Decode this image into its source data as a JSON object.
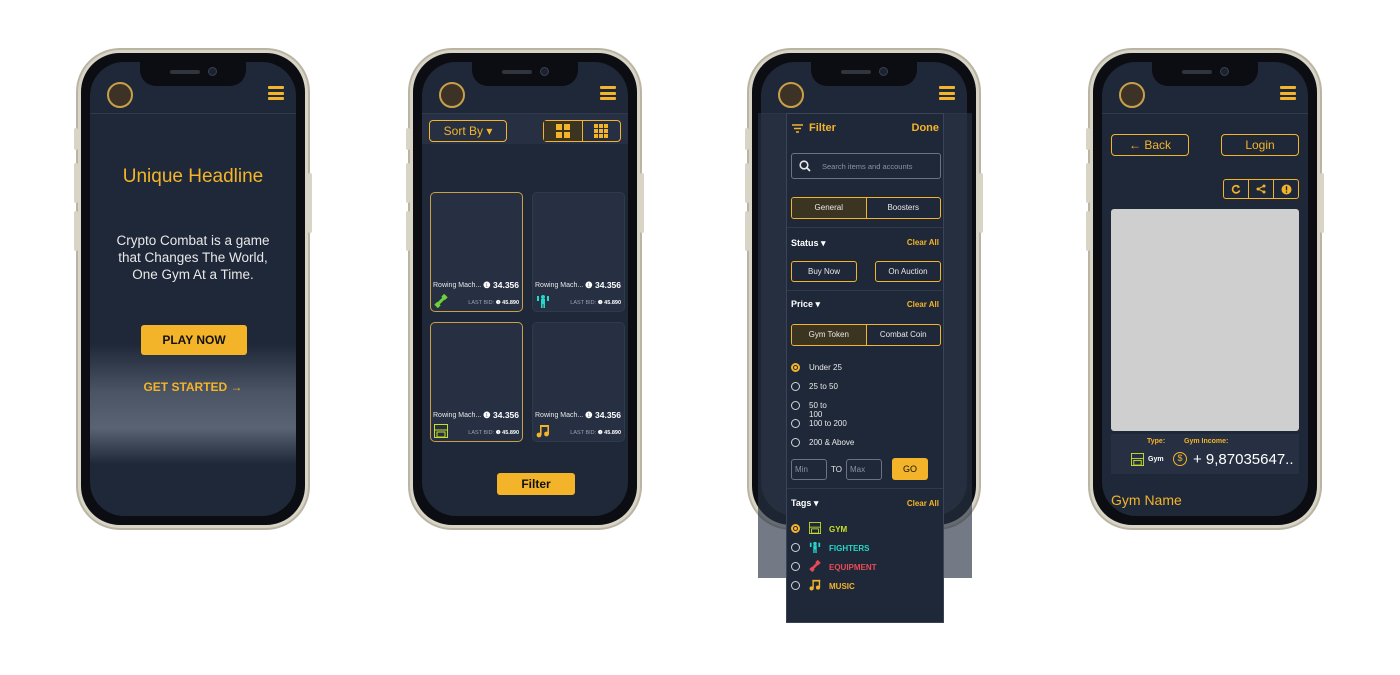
{
  "screen1": {
    "headline": "Unique Headline",
    "tagline": "Crypto Combat is  a game that Changes The World, One Gym At a Time.",
    "play_label": "PLAY NOW",
    "get_started_label": "GET STARTED →"
  },
  "screen2": {
    "sort_label": "Sort By ▾",
    "cards": [
      {
        "name": "Rowing Mach...",
        "price": "❶ 34.356",
        "last_bid_label": "LAST BID:",
        "last_bid": "❶ 45.890",
        "icon": "dumbbell-icon"
      },
      {
        "name": "Rowing Mach...",
        "price": "❶ 34.356",
        "last_bid_label": "LAST BID:",
        "last_bid": "❶ 45.890",
        "icon": "fighter-icon"
      },
      {
        "name": "Rowing Mach...",
        "price": "❶ 34.356",
        "last_bid_label": "LAST BID:",
        "last_bid": "❶ 45.890",
        "icon": "gym-icon"
      },
      {
        "name": "Rowing Mach...",
        "price": "❶ 34.356",
        "last_bid_label": "LAST BID:",
        "last_bid": "❶ 45.890",
        "icon": "music-icon"
      }
    ],
    "filter_label": "Filter"
  },
  "screen3": {
    "title": "Filter",
    "done_label": "Done",
    "search_placeholder": "Search items and accounts",
    "tabs": [
      "General",
      "Boosters"
    ],
    "status": {
      "title": "Status ▾",
      "clear": "Clear All",
      "options": [
        "Buy Now",
        "On Auction"
      ]
    },
    "price": {
      "title": "Price ▾",
      "clear": "Clear All",
      "currencies": [
        "Gym Token",
        "Combat Coin"
      ],
      "ranges": [
        "Under 25",
        "25 to 50",
        "50 to 100",
        "100 to 200",
        "200 & Above"
      ],
      "min_placeholder": "Min",
      "to_label": "TO",
      "max_placeholder": "Max",
      "go_label": "GO"
    },
    "tags": {
      "title": "Tags ▾",
      "clear": "Clear All",
      "items": [
        {
          "label": "GYM",
          "color": "#c6e02a",
          "icon": "gym-icon"
        },
        {
          "label": "FIGHTERS",
          "color": "#27d6c8",
          "icon": "fighter-icon"
        },
        {
          "label": "EQUIPMENT",
          "color": "#e84a55",
          "icon": "dumbbell-icon"
        },
        {
          "label": "MUSIC",
          "color": "#f4b429",
          "icon": "music-icon"
        }
      ]
    }
  },
  "screen4": {
    "back_label": "← Back",
    "login_label": "Login",
    "type_label": "Type:",
    "type_value": "Gym",
    "income_label": "Gym Income:",
    "income_value": "+ 9,87035647..",
    "gym_name": "Gym Name"
  },
  "colors": {
    "accent": "#f4b429",
    "screen_bg": "#1f2838"
  }
}
